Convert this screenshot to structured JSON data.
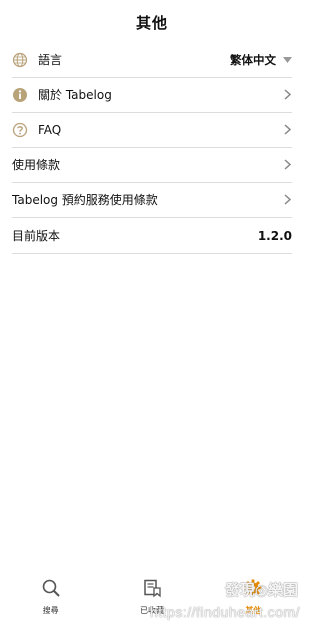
{
  "header": {
    "title": "其他"
  },
  "rows": [
    {
      "label": "語言",
      "value": "繁体中文",
      "icon": "globe-icon"
    },
    {
      "label": "關於 Tabelog",
      "icon": "info-icon"
    },
    {
      "label": "FAQ",
      "icon": "question-icon"
    },
    {
      "label": "使用條款"
    },
    {
      "label": "Tabelog 預約服務使用條款"
    },
    {
      "label": "目前版本",
      "value": "1.2.0"
    }
  ],
  "tabs": [
    {
      "label": "搜尋",
      "icon": "search-icon"
    },
    {
      "label": "已收藏",
      "icon": "bookmark-list-icon"
    },
    {
      "label": "其他",
      "icon": "gear-icon",
      "active": true
    }
  ],
  "watermark": {
    "text_top": "發現◎樂園",
    "text_bottom": "https://finduheart.com/"
  },
  "colors": {
    "accent": "#e58a00",
    "icon_gold": "#b8a27a",
    "divider": "#dcdcdc"
  }
}
